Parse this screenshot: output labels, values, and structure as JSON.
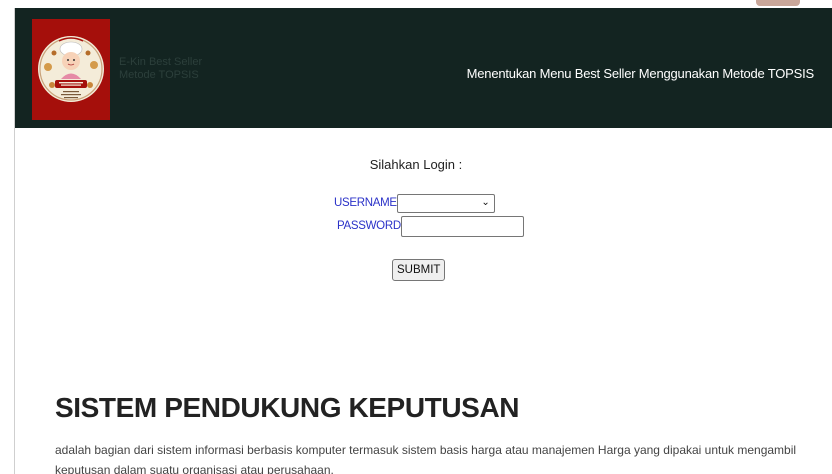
{
  "header": {
    "brand_line1": "E-Kin Best Seller",
    "brand_line2": "Metode TOPSIS",
    "title": "Menentukan Menu Best Seller Menggunakan Metode TOPSIS",
    "logo_icon": "bakery-chef-logo"
  },
  "login": {
    "heading": "Silahkan Login :",
    "username_label": "USERNAME",
    "username_value": "",
    "password_label": "PASSWORD",
    "password_value": "",
    "submit_label": "SUBMIT"
  },
  "section": {
    "title": "SISTEM PENDUKUNG KEPUTUSAN",
    "description": "adalah bagian dari sistem informasi berbasis komputer termasuk sistem basis harga atau manajemen Harga yang dipakai untuk mengambil keputusan dalam suatu organisasi atau perusahaan."
  },
  "colors": {
    "header_bg": "#132421",
    "logo_bg": "#a50f0b",
    "label_blue": "#2b32c8"
  }
}
